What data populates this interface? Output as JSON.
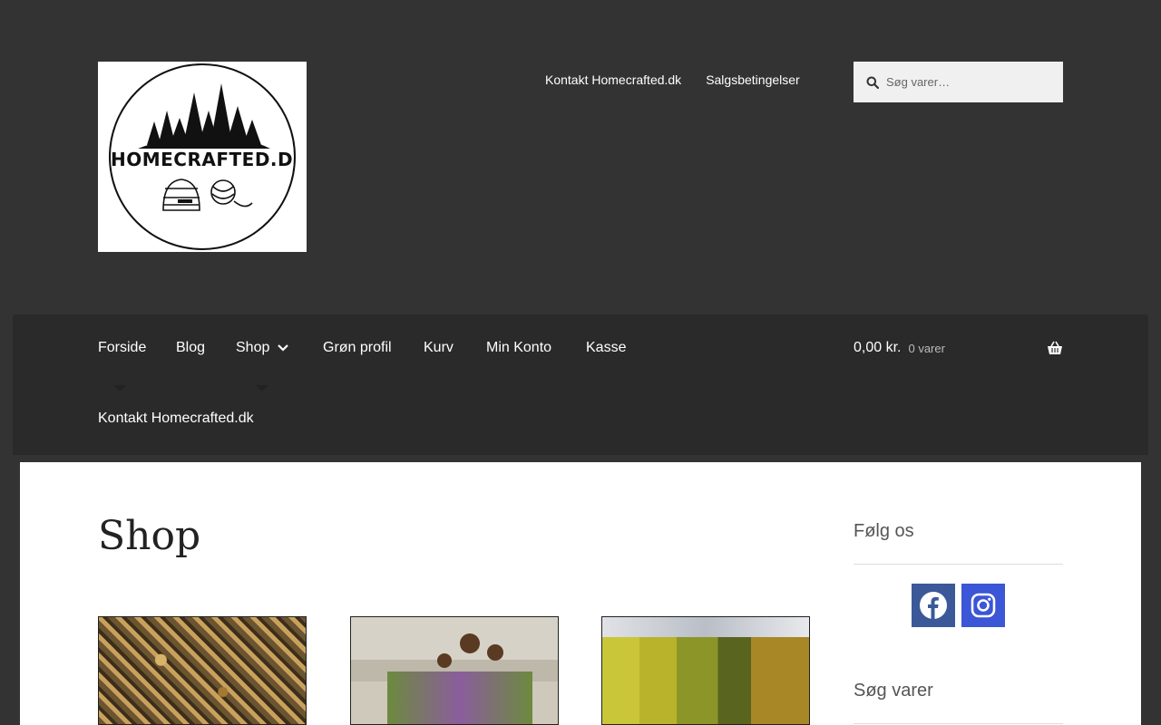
{
  "header": {
    "logo_text": "HOMECRAFTED.DK",
    "top_links": [
      "Kontakt Homecrafted.dk",
      "Salgsbetingelser"
    ],
    "search": {
      "placeholder": "Søg varer…",
      "icon": "search-icon"
    }
  },
  "nav": {
    "items": [
      "Forside",
      "Blog",
      "Shop",
      "Grøn profil",
      "Kurv",
      "Min Konto",
      "Kasse"
    ],
    "second_row": "Kontakt Homecrafted.dk",
    "cart": {
      "total": "0,00 kr.",
      "count": "0 varer",
      "icon": "basket-icon"
    }
  },
  "main": {
    "title": "Shop"
  },
  "sidebar": {
    "follow_heading": "Følg os",
    "social": [
      "facebook-icon",
      "instagram-icon"
    ],
    "search_heading": "Søg varer"
  },
  "colors": {
    "header_bg": "#333333",
    "nav_bg": "#2a2a2a",
    "facebook": "#3b5998",
    "instagram": "#3b56d6"
  }
}
